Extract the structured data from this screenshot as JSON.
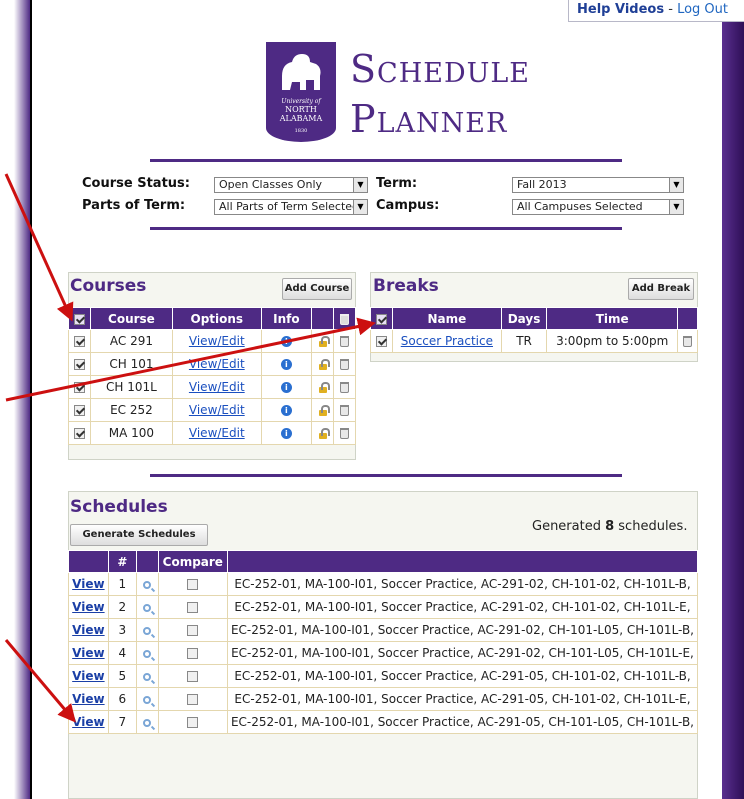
{
  "header": {
    "help_videos": "Help Videos",
    "separator": "-",
    "logout": "Log Out"
  },
  "logo": {
    "line1": "University of",
    "line2": "NORTH",
    "line3": "ALABAMA",
    "line4": "1830"
  },
  "title": {
    "line1": "Schedule",
    "line2": "Planner"
  },
  "filters": {
    "course_status_label": "Course Status:",
    "course_status_value": "Open Classes Only",
    "term_label": "Term:",
    "term_value": "Fall 2013",
    "parts_label": "Parts of Term:",
    "parts_value": "All Parts of Term Selected",
    "campus_label": "Campus:",
    "campus_value": "All Campuses Selected"
  },
  "courses": {
    "title": "Courses",
    "add_button": "Add Course",
    "headers": [
      "Course",
      "Options",
      "Info"
    ],
    "rows": [
      {
        "course": "AC 291",
        "option": "View/Edit"
      },
      {
        "course": "CH 101",
        "option": "View/Edit"
      },
      {
        "course": "CH 101L",
        "option": "View/Edit"
      },
      {
        "course": "EC 252",
        "option": "View/Edit"
      },
      {
        "course": "MA 100",
        "option": "View/Edit"
      }
    ]
  },
  "breaks": {
    "title": "Breaks",
    "add_button": "Add Break",
    "headers": [
      "Name",
      "Days",
      "Time"
    ],
    "rows": [
      {
        "name": "Soccer Practice",
        "days": "TR",
        "time": "3:00pm to 5:00pm"
      }
    ]
  },
  "schedules": {
    "title": "Schedules",
    "generate_button": "Generate Schedules",
    "generated_prefix": "Generated ",
    "generated_count": "8",
    "generated_suffix": " schedules.",
    "headers": [
      "#",
      "Compare"
    ],
    "rows": [
      {
        "view": "View",
        "num": "1",
        "text": "EC-252-01, MA-100-I01, Soccer Practice, AC-291-02, CH-101-02, CH-101L-B,"
      },
      {
        "view": "View",
        "num": "2",
        "text": "EC-252-01, MA-100-I01, Soccer Practice, AC-291-02, CH-101-02, CH-101L-E,"
      },
      {
        "view": "View",
        "num": "3",
        "text": "EC-252-01, MA-100-I01, Soccer Practice, AC-291-02, CH-101-L05, CH-101L-B,"
      },
      {
        "view": "View",
        "num": "4",
        "text": "EC-252-01, MA-100-I01, Soccer Practice, AC-291-02, CH-101-L05, CH-101L-E,"
      },
      {
        "view": "View",
        "num": "5",
        "text": "EC-252-01, MA-100-I01, Soccer Practice, AC-291-05, CH-101-02, CH-101L-B,"
      },
      {
        "view": "View",
        "num": "6",
        "text": "EC-252-01, MA-100-I01, Soccer Practice, AC-291-05, CH-101-02, CH-101L-E,"
      },
      {
        "view": "View",
        "num": "7",
        "text": "EC-252-01, MA-100-I01, Soccer Practice, AC-291-05, CH-101-L05, CH-101L-B,"
      }
    ]
  },
  "colors": {
    "brand_purple": "#4e2a84",
    "annotation_arrow": "#cc1010"
  }
}
